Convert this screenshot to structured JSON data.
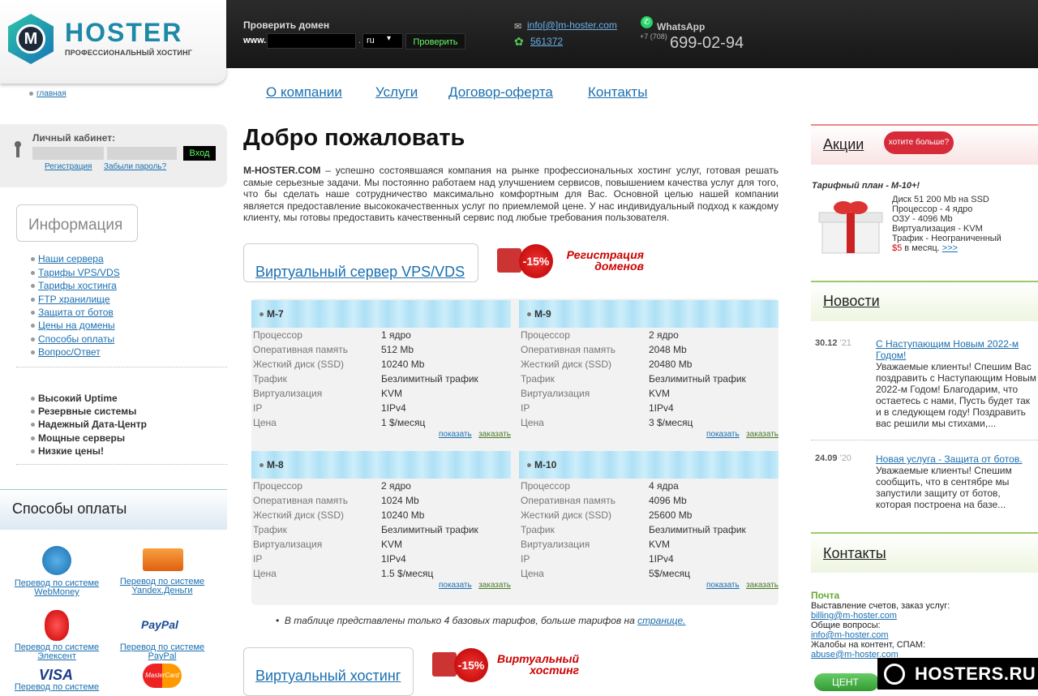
{
  "logo": {
    "name": "HOSTER",
    "letter": "M",
    "tagline": "ПРОФЕССИОНАЛЬНЫЙ ХОСТИНГ"
  },
  "breadcrumb": {
    "home": "главная"
  },
  "domain_check": {
    "label": "Проверить домен",
    "prefix": "www.",
    "value": "",
    "dot": ".",
    "tld": "ru",
    "button": "Проверить"
  },
  "contacts_top": {
    "email": "info[@]m-hoster.com",
    "icq": "561372",
    "whatsapp_label": "WhatsApp",
    "phone_code": "+7 (708)",
    "phone": "699-02-94"
  },
  "nav": [
    "О компании",
    "Услуги",
    "Договор-оферта",
    "Контакты"
  ],
  "login": {
    "label": "Личный кабинет:",
    "user": "",
    "pass": "",
    "button": "Вход",
    "register": "Регистрация",
    "forgot": "Забыли пароль?"
  },
  "info": {
    "title": "Информация",
    "links": [
      "Наши сервера",
      "Тарифы VPS/VDS",
      "Тарифы хостинга",
      "FTP хранилище",
      "Защита от ботов",
      "Цены на домены",
      "Способы оплаты",
      "Вопрос/Ответ"
    ],
    "features": [
      "Высокий Uptime",
      "Резервные системы",
      "Надежный Дата-Центр",
      "Мощные серверы",
      "Низкие цены!"
    ]
  },
  "payment": {
    "title": "Способы оплаты",
    "items": [
      {
        "line1": "Перевод по системе",
        "line2": "WebMoney",
        "icon": "webmoney-icon",
        "color": "#1a6fb0"
      },
      {
        "line1": "Перевод по системе",
        "line2": "Yandex.Деньги",
        "icon": "yandex-money-icon",
        "color": "#f07020"
      },
      {
        "line1": "Перевод по системе",
        "line2": "Элексент",
        "icon": "elexnet-icon",
        "color": "#d22"
      },
      {
        "line1": "Перевод по системе",
        "line2": "PayPal",
        "icon": "paypal-icon",
        "color": "#1a4a9a"
      },
      {
        "line1": "Перевод по системе",
        "line2": "",
        "icon": "visa-icon",
        "color": "#1a3a8a"
      },
      {
        "line1": "",
        "line2": "",
        "icon": "mastercard-icon",
        "color": "#e33"
      }
    ],
    "visa_text": "VISA",
    "paypal_text": "PayPal",
    "mc_text": "MasterCard"
  },
  "main": {
    "title": "Добро пожаловать",
    "intro_brand": "M-HOSTER.COM",
    "intro": " – успешно состоявшаяся компания на рынке профессиональных хостинг услуг, готовая решать самые серьезные задачи. Мы постоянно работаем над улучшением сервисов, повышением качества услуг для того, что бы сделать наше сотрудничество максимально комфортным для Вас. Основной целью нашей компании является предоставление высококачественных услуг по приемлемой цене. У нас индивидуальный подход к каждому клиенту, мы готовы предоставить качественный сервис под любые требования пользователя.",
    "vps_tab": "Виртуальный сервер VPS/VDS",
    "promo1": {
      "badge": "-15%",
      "line1": "Регистрация",
      "line2": "доменов"
    },
    "hosting_tab": "Виртуальный хостинг",
    "promo2": {
      "badge": "-15%",
      "line1": "Виртуальный",
      "line2": "хостинг"
    },
    "row_labels": [
      "Процессор",
      "Оперативная память",
      "Жесткий диск (SSD)",
      "Трафик",
      "Виртуализация",
      "IP",
      "Цена"
    ],
    "plans": [
      {
        "name": "M-7",
        "values": [
          "1 ядро",
          "512 Mb",
          "10240 Mb",
          "Безлимитный трафик",
          "KVM",
          "1IPv4",
          "1 $/месяц"
        ]
      },
      {
        "name": "M-9",
        "values": [
          "2 ядро",
          "2048 Mb",
          "20480 Mb",
          "Безлимитный трафик",
          "KVM",
          "1IPv4",
          "3 $/месяц"
        ]
      },
      {
        "name": "M-8",
        "values": [
          "2 ядро",
          "1024 Mb",
          "10240 Mb",
          "Безлимитный трафик",
          "KVM",
          "1IPv4",
          "1.5 $/месяц"
        ]
      },
      {
        "name": "M-10",
        "values": [
          "4 ядра",
          "4096 Mb",
          "25600 Mb",
          "Безлимитный трафик",
          "KVM",
          "1IPv4",
          "5$/месяц"
        ]
      }
    ],
    "show": "показать",
    "order": "заказать",
    "note": "В таблице представлены только 4 базовых тарифов, больше тарифов на ",
    "note_link": "странице."
  },
  "promo_right": {
    "title": "Акции",
    "want_more": "хотите больше?",
    "plan": "Тарифный план - M-10+!",
    "lines": [
      "Диск 51 200 Mb на SSD",
      "Процессор - 4 ядро",
      "ОЗУ - 4096 Mb",
      "Виртуализация - KVM",
      "Трафик - Неограниченный"
    ],
    "price": "$5",
    "price_suffix": " в месяц. ",
    "more": ">>>"
  },
  "news": {
    "title": "Новости",
    "items": [
      {
        "day": "30.12",
        "year": "'21",
        "title": "С Наступающим Новым 2022-м Годом!",
        "body": "Уважаемые клиенты! Спешим Вас поздравить с Наступающим Новым 2022-м Годом! Благодарим, что остаетесь с нами, Пусть будет так и в следующем году! Поздравить вас решили мы стихами,..."
      },
      {
        "day": "24.09",
        "year": "'20",
        "title": "Новая услуга - Защита от ботов.",
        "body": "Уважаемые клиенты! Спешим сообщить, что в сентябре мы запустили защиту от ботов, которая построена на базе..."
      }
    ]
  },
  "contacts": {
    "title": "Контакты",
    "mail_label": "Почта",
    "billing_label": "Выставление счетов, заказ услуг:",
    "billing": "billing@m-hoster.com",
    "general_label": "Общие вопросы:",
    "general": "info@m-hoster.com",
    "abuse_label": "Жалобы на контент, СПАМ:",
    "abuse": "abuse@m-hoster.com",
    "center_btn": "ЦЕНТ"
  },
  "watermark": "HOSTERS.RU"
}
